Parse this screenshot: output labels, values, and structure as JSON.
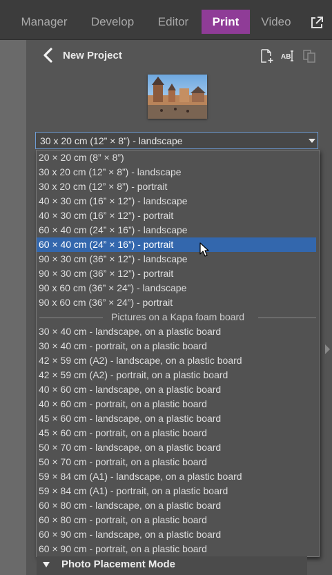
{
  "nav": {
    "tabs": [
      {
        "label": "Manager",
        "active": false
      },
      {
        "label": "Develop",
        "active": false
      },
      {
        "label": "Editor",
        "active": false
      },
      {
        "label": "Print",
        "active": true
      },
      {
        "label": "Video",
        "active": false
      }
    ],
    "accent_color": "#8f3c97",
    "external_icon": "external-link-icon"
  },
  "project": {
    "title": "New Project",
    "back_icon": "chevron-left-icon",
    "toolbar_icons": [
      "new-page-icon",
      "rename-icon",
      "duplicate-icon"
    ]
  },
  "format_select": {
    "value": "30 x 20 cm (12” × 8”) - landscape",
    "options": [
      "20 × 20 cm (8” × 8”)",
      "30 x 20 cm (12” × 8”) - landscape",
      "30 x 20 cm (12” × 8”) - portrait",
      "40 × 30 cm (16” × 12”) - landscape",
      "40 × 30 cm (16” × 12”) - portrait",
      "60 × 40 cm (24” × 16”) - landscape",
      "60 × 40 cm (24” × 16”) - portrait",
      "90 × 30 cm (36” × 12”) - landscape",
      "90 × 30 cm (36” × 12”) - portrait",
      "90 x 60 cm (36” × 24”) - landscape",
      "90 x 60 cm (36” × 24”) - portrait"
    ],
    "highlighted": "60 × 40 cm (24” × 16”) - portrait",
    "group_header": "Pictures on a Kapa foam board",
    "board_options": [
      "30 × 40 cm - landscape, on a plastic board",
      "30 × 40 cm - portrait, on a plastic board",
      "42 × 59 cm (A2) - landscape, on a plastic board",
      "42 × 59 cm (A2) - portrait, on a plastic board",
      "40 × 60 cm - landscape, on a plastic board",
      "40 × 60 cm - portrait, on a plastic board",
      "45 × 60 cm - landscape, on a plastic board",
      "45 × 60 cm - portrait, on a plastic board",
      "50 × 70 cm - landscape, on a plastic board",
      "50 × 70 cm - portrait, on a plastic board",
      "59 × 84 cm (A1) - landscape, on a plastic board",
      "59 × 84 cm (A1) - portrait, on a plastic board",
      "60 × 80 cm - landscape, on a plastic board",
      "60 × 80 cm - portrait, on a plastic board",
      "60 × 90 cm - landscape, on a plastic board",
      "60 × 90 cm - portrait, on a plastic board"
    ],
    "highlight_color": "#3367ad"
  },
  "section": {
    "label": "Photo Placement Mode",
    "icon": "caret-down-icon"
  }
}
